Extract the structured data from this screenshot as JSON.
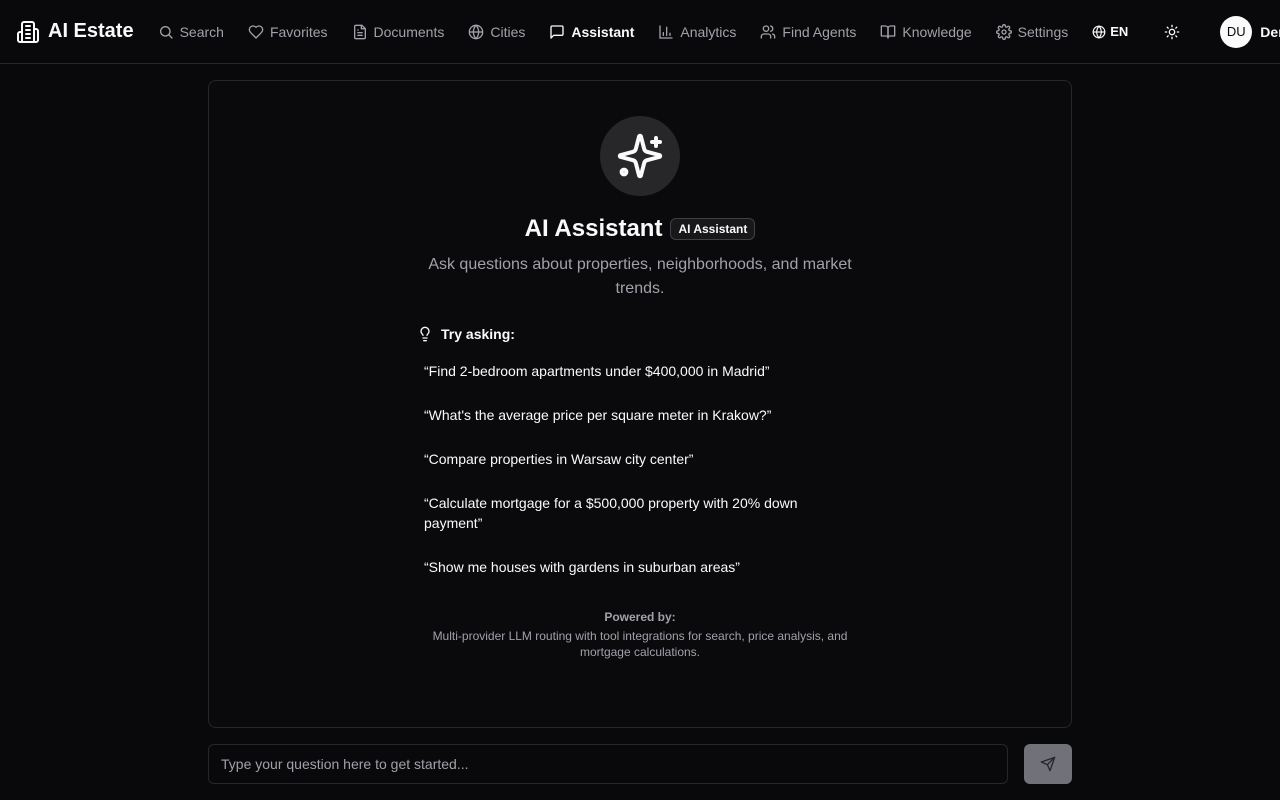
{
  "app": {
    "name": "AI Estate"
  },
  "nav": {
    "items": [
      {
        "label": "Search",
        "icon": "search-icon",
        "active": false
      },
      {
        "label": "Favorites",
        "icon": "heart-icon",
        "active": false
      },
      {
        "label": "Documents",
        "icon": "document-icon",
        "active": false
      },
      {
        "label": "Cities",
        "icon": "globe-icon",
        "active": false
      },
      {
        "label": "Assistant",
        "icon": "message-icon",
        "active": true
      },
      {
        "label": "Analytics",
        "icon": "bar-chart-icon",
        "active": false
      },
      {
        "label": "Find Agents",
        "icon": "users-icon",
        "active": false
      },
      {
        "label": "Knowledge",
        "icon": "book-icon",
        "active": false
      },
      {
        "label": "Settings",
        "icon": "gear-icon",
        "active": false
      }
    ],
    "language": "EN",
    "user": {
      "initials": "DU",
      "name": "Demo User"
    }
  },
  "assistant": {
    "title": "AI Assistant",
    "badge": "AI Assistant",
    "subtitle": "Ask questions about properties, neighborhoods, and market trends.",
    "try_label": "Try asking:",
    "suggestions": [
      "“Find 2-bedroom apartments under $400,000 in Madrid”",
      "“What's the average price per square meter in Krakow?”",
      "“Compare properties in Warsaw city center”",
      "“Calculate mortgage for a $500,000 property with 20% down payment”",
      "“Show me houses with gardens in suburban areas”"
    ],
    "powered_label": "Powered by:",
    "powered_text": "Multi-provider LLM routing with tool integrations for search, price analysis, and mortgage calculations."
  },
  "input": {
    "placeholder": "Type your question here to get started..."
  },
  "colors": {
    "background": "#09090b",
    "border": "#27272a",
    "muted": "#a1a1aa",
    "send": "#71717a"
  }
}
